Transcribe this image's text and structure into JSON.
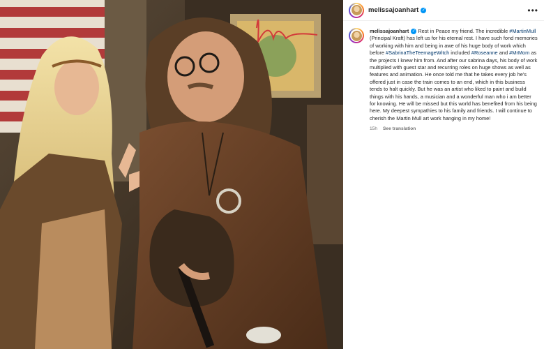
{
  "post": {
    "username": "melissajoanhart",
    "verified_icon": "verified-badge-icon",
    "more_icon": "more-options-icon"
  },
  "caption": {
    "username": "melissajoanhart",
    "segments": [
      {
        "text": "Rest in Peace my friend. The incredible ",
        "tag": false
      },
      {
        "text": "#MartinMull",
        "tag": true
      },
      {
        "text": " (Principal Kraft) has left us for his eternal rest. I have such fond memories of working with him and being in awe of his huge body of work which before ",
        "tag": false
      },
      {
        "text": "#SabrinaTheTeemageWitch",
        "tag": true
      },
      {
        "text": " included ",
        "tag": false
      },
      {
        "text": "#Roseanne",
        "tag": true
      },
      {
        "text": " and ",
        "tag": false
      },
      {
        "text": "#MrMom",
        "tag": true
      },
      {
        "text": " as the projects I knew him from. And after our sabrina days, his body of work multiplied with guest star and recurring roles on huge shows as well as features and animation. He once told me that he takes every job he's offered just in case the train comes to an end, which in this business tends to halt quickly. But he was an artist who liked to paint and build things with his hands, a musician and a wonderful man who i am better for knowing. He will be missed but this world has benefited from his being here. My deepest sympathies to his family and friends. I will continue to cherish the Martin Mull art work hanging in my home!",
        "tag": false
      }
    ],
    "time": "15h",
    "see_translation": "See translation"
  },
  "colors": {
    "hashtag": "#00376b",
    "verified": "#0095f6",
    "muted": "#737373"
  }
}
